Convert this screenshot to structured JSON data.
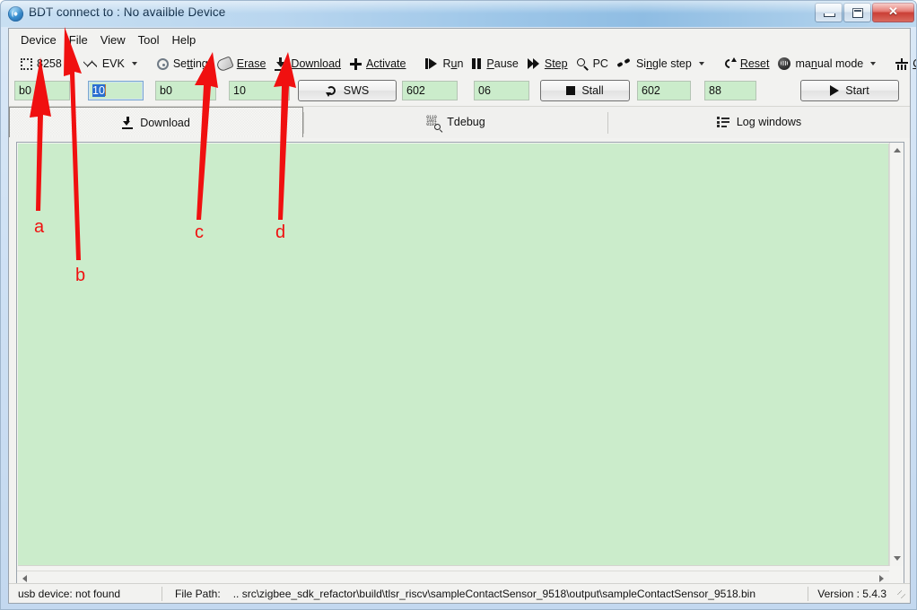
{
  "window": {
    "title": "BDT connect to : No availble Device",
    "app_icon": "globe-icon",
    "minimize_label": "",
    "maximize_label": "",
    "close_label": "✕"
  },
  "menubar": {
    "items": [
      {
        "label": "Device"
      },
      {
        "label": "File"
      },
      {
        "label": "View"
      },
      {
        "label": "Tool"
      },
      {
        "label": "Help"
      }
    ]
  },
  "toolbar": {
    "chip_selector": {
      "icon": "chip-icon",
      "value": "8258"
    },
    "evk_selector": {
      "icon": "waveform-icon",
      "value": "EVK"
    },
    "setting": {
      "icon": "gear-icon",
      "label": "Setting"
    },
    "erase": {
      "icon": "eraser-icon",
      "label": "Erase"
    },
    "download": {
      "icon": "download-arrow-icon",
      "label": "Download"
    },
    "activate": {
      "icon": "plus-icon",
      "label": "Activate"
    },
    "run": {
      "icon": "run-icon",
      "label": "Run"
    },
    "pause": {
      "icon": "pause-icon",
      "label": "Pause"
    },
    "step": {
      "icon": "step-forward-icon",
      "label": "Step"
    },
    "pc": {
      "icon": "magnifier-icon",
      "label": "PC"
    },
    "single_step": {
      "icon": "footsteps-icon",
      "label": "Single step"
    },
    "reset": {
      "icon": "reset-circular-arrow-icon",
      "label": "Reset"
    },
    "manual_mode": {
      "icon": "knob-icon",
      "label": "manual mode"
    },
    "clear": {
      "icon": "broom-icon",
      "label": "Clear"
    }
  },
  "fields": {
    "addr1": {
      "value": "b0",
      "placeholder": ""
    },
    "len1": {
      "value": "10",
      "placeholder": "",
      "selected": true
    },
    "addr2": {
      "value": "b0",
      "placeholder": ""
    },
    "len2": {
      "value": "10",
      "placeholder": ""
    },
    "sws_button": {
      "icon": "refresh-icon",
      "label": "SWS"
    },
    "val1": {
      "value": "602",
      "placeholder": ""
    },
    "val2": {
      "value": "06",
      "placeholder": ""
    },
    "stall_button": {
      "icon": "stop-square-icon",
      "label": "Stall"
    },
    "val3": {
      "value": "602",
      "placeholder": ""
    },
    "val4": {
      "value": "88",
      "placeholder": ""
    },
    "start_button": {
      "icon": "play-icon",
      "label": "Start"
    }
  },
  "tabs": [
    {
      "id": "download",
      "label": "Download",
      "icon": "download-arrow-icon",
      "selected": true
    },
    {
      "id": "tdebug",
      "label": "Tdebug",
      "icon": "binary-magnifier-icon",
      "selected": false
    },
    {
      "id": "log",
      "label": "Log windows",
      "icon": "list-icon",
      "selected": false
    }
  ],
  "content": {
    "log_text": "",
    "background_color": "#cbeccb"
  },
  "statusbar": {
    "usb_status": "usb device: not found",
    "file_path_label": "File Path:",
    "file_path_value": "..  src\\zigbee_sdk_refactor\\build\\tlsr_riscv\\sampleContactSensor_9518\\output\\sampleContactSensor_9518.bin",
    "version": "Version : 5.4.3"
  },
  "annotations": {
    "color": "#f01010",
    "markers": [
      {
        "letter": "a",
        "target": "chip-selector-8258"
      },
      {
        "letter": "b",
        "target": "menu-file"
      },
      {
        "letter": "c",
        "target": "erase-button"
      },
      {
        "letter": "d",
        "target": "download-button"
      }
    ]
  }
}
